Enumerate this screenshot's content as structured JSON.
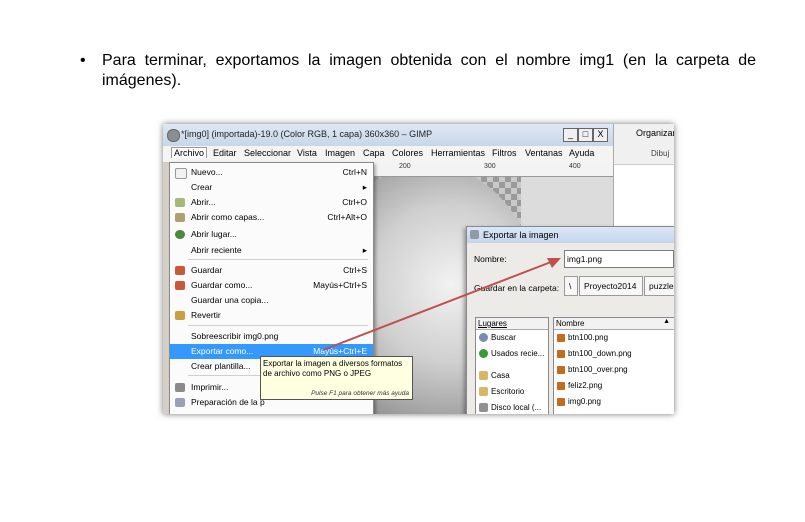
{
  "document": {
    "bullet": "•",
    "text": "Para terminar, exportamos la imagen obtenida con el nombre img1 (en la carpeta de imágenes)."
  },
  "gimp": {
    "title": "*[img0] (importada)-19.0 (Color RGB, 1 capa) 360x360 – GIMP",
    "window_buttons": [
      "_",
      "□",
      "X"
    ],
    "menubar": [
      "Archivo",
      "Editar",
      "Seleccionar",
      "Vista",
      "Imagen",
      "Capa",
      "Colores",
      "Herramientas",
      "Filtros",
      "Ventanas",
      "Ayuda"
    ],
    "ruler_ticks": [
      "200",
      "300",
      "400"
    ],
    "file_menu": [
      {
        "label": "Nuevo...",
        "shortcut": "Ctrl+N",
        "icon": "new-file-icon"
      },
      {
        "label": "Crear",
        "shortcut": "▸",
        "icon": ""
      },
      {
        "label": "Abrir...",
        "shortcut": "Ctrl+O",
        "icon": "open-icon"
      },
      {
        "label": "Abrir como capas...",
        "shortcut": "Ctrl+Alt+O",
        "icon": "open-layers-icon"
      },
      {
        "label": "Abrir lugar...",
        "shortcut": "",
        "icon": "globe-icon"
      },
      {
        "label": "Abrir reciente",
        "shortcut": "▸",
        "icon": ""
      },
      {
        "label": "Guardar",
        "shortcut": "Ctrl+S",
        "icon": "save-icon"
      },
      {
        "label": "Guardar como...",
        "shortcut": "Mayús+Ctrl+S",
        "icon": "save-as-icon"
      },
      {
        "label": "Guardar una copia...",
        "shortcut": "",
        "icon": ""
      },
      {
        "label": "Revertir",
        "shortcut": "",
        "icon": "revert-icon"
      },
      {
        "label": "Sobreescribir img0.png",
        "shortcut": "",
        "icon": ""
      },
      {
        "label": "Exportar como...",
        "shortcut": "Mayús+Ctrl+E",
        "icon": ""
      },
      {
        "label": "Crear plantilla...",
        "shortcut": "",
        "icon": ""
      },
      {
        "label": "Imprimir...",
        "shortcut": "",
        "icon": "print-icon"
      },
      {
        "label": "Preparación de la p",
        "shortcut": "",
        "icon": "page-setup-icon"
      }
    ],
    "tooltip": {
      "text": "Exportar la imagen a diversos formatos de archivo como PNG o JPEG",
      "hint": "Pulse F1 para obtener más ayuda"
    }
  },
  "right_pane": {
    "organize": "Organizar",
    "dibujo": "Dibuj"
  },
  "export_dialog": {
    "title": "Exportar la imagen",
    "name_label": "Nombre:",
    "name_value": "img1.png",
    "folder_label": "Guardar en la carpeta:",
    "breadcrumb": [
      "\\",
      "Proyecto2014",
      "puzzles"
    ],
    "places_header": "Lugares",
    "places": [
      {
        "label": "Buscar",
        "icon": "search-icon"
      },
      {
        "label": "Usados recie...",
        "icon": "recent-icon"
      },
      {
        "label": "Casa",
        "icon": "folder-icon"
      },
      {
        "label": "Escritorio",
        "icon": "desktop-icon"
      },
      {
        "label": "Disco local (...",
        "icon": "drive-icon"
      }
    ],
    "files_header": "Nombre",
    "files": [
      "btn100.png",
      "btn100_down.png",
      "btn100_over.png",
      "feliz2.png",
      "img0.png"
    ]
  },
  "colors": {
    "highlight": "#3399ff",
    "arrow": "#c0504d",
    "tooltip_bg": "#ffffe1"
  }
}
